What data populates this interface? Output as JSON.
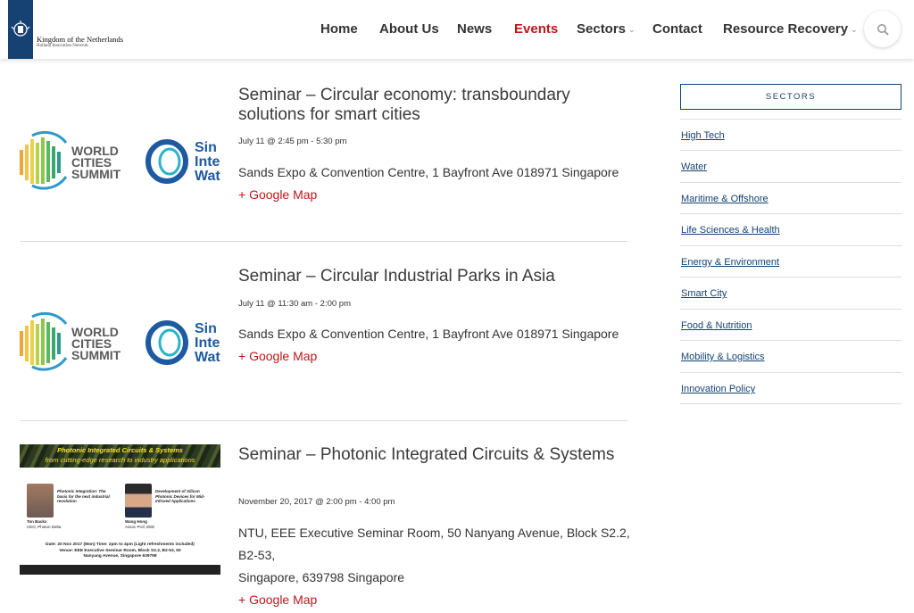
{
  "logo": {
    "line1": "Kingdom of the Netherlands",
    "line2": "Holland Innovation Network"
  },
  "nav": {
    "items": [
      {
        "label": "Home",
        "active": false
      },
      {
        "label": "About Us",
        "active": false
      },
      {
        "label": "News",
        "active": false
      },
      {
        "label": "Events",
        "active": true
      },
      {
        "label": "Sectors",
        "active": false,
        "dropdown": true
      },
      {
        "label": "Contact",
        "active": false
      },
      {
        "label": "Resource Recovery",
        "active": false,
        "dropdown": true
      }
    ],
    "search_icon": "search-icon"
  },
  "events": [
    {
      "title": "Seminar – Circular economy: transboundary solutions for smart cities",
      "date": "July 11 @ 2:45 pm - 5:30 pm",
      "venue": "Sands Expo & Convention Centre, 1 Bayfront Ave 018971 Singapore",
      "map_link": "+ Google Map",
      "image": {
        "logo1_line1": "WORLD",
        "logo1_line2": "CITIES",
        "logo1_line3": "SUMMIT",
        "logo2_line1": "Sin",
        "logo2_line2": "Inte",
        "logo2_line3": "Wat"
      }
    },
    {
      "title": "Seminar – Circular Industrial Parks in Asia",
      "date": "July 11 @ 11:30 am - 2:00 pm",
      "venue": "Sands Expo & Convention Centre, 1 Bayfront Ave 018971 Singapore",
      "map_link": "+ Google Map",
      "image": {
        "logo1_line1": "WORLD",
        "logo1_line2": "CITIES",
        "logo1_line3": "SUMMIT",
        "logo2_line1": "Sin",
        "logo2_line2": "Inte",
        "logo2_line3": "Wat"
      }
    },
    {
      "title": "Seminar – Photonic Integrated Circuits & Systems",
      "date": "November 20, 2017 @ 2:00 pm - 4:00 pm",
      "venue_line1": "NTU, EEE Executive Seminar Room, 50 Nanyang Avenue, Block S2.2, B2-53,",
      "venue_line2": "Singapore, 639798 Singapore",
      "map_link": "+ Google Map",
      "poster": {
        "heading": "Photonic Integrated Circuits & Systems",
        "subheading": "from cutting-edge research to industry applications",
        "talk1": "Photonic Integration: The basis for the next industrial revolution",
        "speaker1": "Ton Backx",
        "speaker1_role": "CEO, Photon Delta",
        "talk2": "Development of Silicon Photonic Devices for Mid-Infrared Applications",
        "speaker2": "Wang Hong",
        "speaker2_role": "Assoc Prof, EEE",
        "date_line": "Date: 20 Nov 2017 (Mon)   Time: 2pm to 4pm (Light refreshments included)",
        "venue_line": "Venue:  EEE Executive Seminar Room, Block S2.2, B2-53, 50",
        "venue_line2": "Nanyang Avenue, Singapore 639798"
      }
    }
  ],
  "sidebar": {
    "heading": "SECTORS",
    "links": [
      "High Tech",
      "Water",
      "Maritime & Offshore",
      "Life Sciences & Health",
      "Energy & Environment",
      "Smart City",
      "Food & Nutrition",
      "Mobility & Logistics",
      "Innovation Policy"
    ]
  },
  "colors": {
    "brand_blue": "#154273",
    "accent_red": "#c0161b"
  }
}
